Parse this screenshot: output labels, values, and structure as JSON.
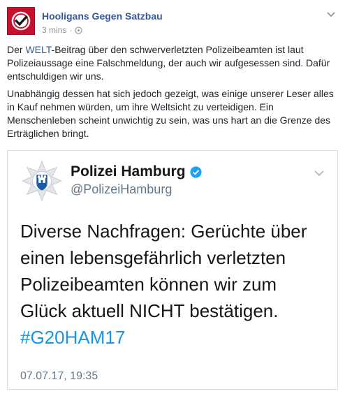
{
  "post": {
    "page_name": "Hooligans Gegen Satzbau",
    "time": "3 mins",
    "separator": "·",
    "privacy_icon": "globe-icon",
    "paragraph1_pre": "Der ",
    "paragraph1_link": "WELT",
    "paragraph1_post": "-Beitrag über den schwerverletzten Polizeibeamten ist laut Polizeiaussage eine Falschmeldung, der auch wir aufgesessen sind. Dafür entschuldigen wir uns.",
    "paragraph2": "Unabhängig dessen hat sich jedoch gezeigt, was einige unserer Leser alles in Kauf nehmen würden, um ihre Weltsicht zu verteidigen. Ein Menschenleben scheint unwichtig zu sein, was uns hart an die Grenze des Erträglichen bringt."
  },
  "tweet": {
    "account_name": "Polizei Hamburg",
    "handle": "@PolizeiHamburg",
    "text": "Diverse Nachfragen: Gerüchte über einen lebensgefährlich verletzten Polizeibeamten können wir zum Glück aktuell NICHT bestätigen.",
    "hashtag": "#G20HAM17",
    "timestamp": "07.07.17, 19:35"
  },
  "colors": {
    "brand_red": "#c8102e",
    "fb_link": "#365899",
    "twitter_blue": "#1b95e0",
    "verified_blue": "#1da1f2"
  }
}
